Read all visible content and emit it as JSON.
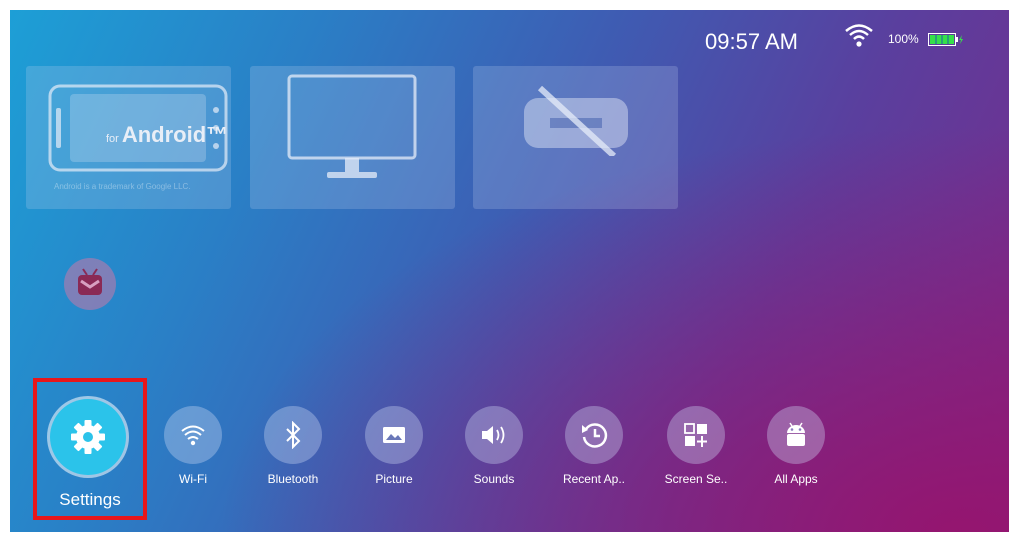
{
  "status": {
    "time": "09:57 AM",
    "battery_percent": "100%",
    "wifi_icon": "wifi-icon",
    "battery_icon": "battery-charging-icon"
  },
  "tiles": [
    {
      "name": "android",
      "text_small": "for",
      "text_main": "Android™",
      "note": "Android is a trademark of Google LLC."
    },
    {
      "name": "display",
      "icon": "monitor-icon"
    },
    {
      "name": "no-link",
      "icon": "link-off-icon"
    }
  ],
  "app_icon": "app-icon",
  "dock": {
    "settings": {
      "label": "Settings",
      "icon": "gear-icon"
    },
    "items": [
      {
        "label": "Wi-Fi",
        "icon": "wifi-icon"
      },
      {
        "label": "Bluetooth",
        "icon": "bluetooth-icon"
      },
      {
        "label": "Picture",
        "icon": "picture-icon"
      },
      {
        "label": "Sounds",
        "icon": "speaker-icon"
      },
      {
        "label": "Recent Ap..",
        "icon": "history-icon"
      },
      {
        "label": "Screen Se..",
        "icon": "grid-plus-icon"
      },
      {
        "label": "All Apps",
        "icon": "android-icon"
      }
    ]
  },
  "colors": {
    "highlight": "#e8161b",
    "settings_accent": "#2bc3ea"
  }
}
